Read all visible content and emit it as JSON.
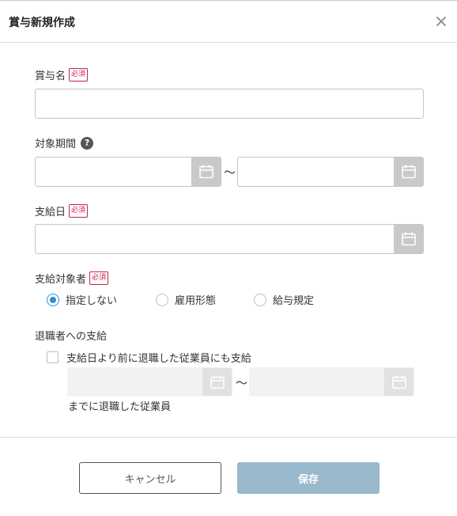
{
  "modal": {
    "title": "賞与新規作成"
  },
  "fields": {
    "bonus_name": {
      "label": "賞与名",
      "required_badge": "必須",
      "value": ""
    },
    "period": {
      "label": "対象期間",
      "help_icon": "?",
      "start": "",
      "end": "",
      "separator": "〜"
    },
    "pay_date": {
      "label": "支給日",
      "required_badge": "必須",
      "value": ""
    },
    "target": {
      "label": "支給対象者",
      "required_badge": "必須",
      "options": [
        {
          "label": "指定しない",
          "selected": true
        },
        {
          "label": "雇用形態",
          "selected": false
        },
        {
          "label": "給与規定",
          "selected": false
        }
      ]
    },
    "retiree": {
      "label": "退職者への支給",
      "checkbox_label": "支給日より前に退職した従業員にも支給",
      "checked": false,
      "separator": "〜",
      "caption": "までに退職した従業員"
    }
  },
  "footer": {
    "cancel_label": "キャンセル",
    "save_label": "保存"
  },
  "colors": {
    "required": "#c8224d",
    "radio_selected": "#2f8fd8",
    "save_button": "#99b9cc"
  },
  "icons": [
    "close-icon",
    "help-icon",
    "calendar-icon"
  ]
}
